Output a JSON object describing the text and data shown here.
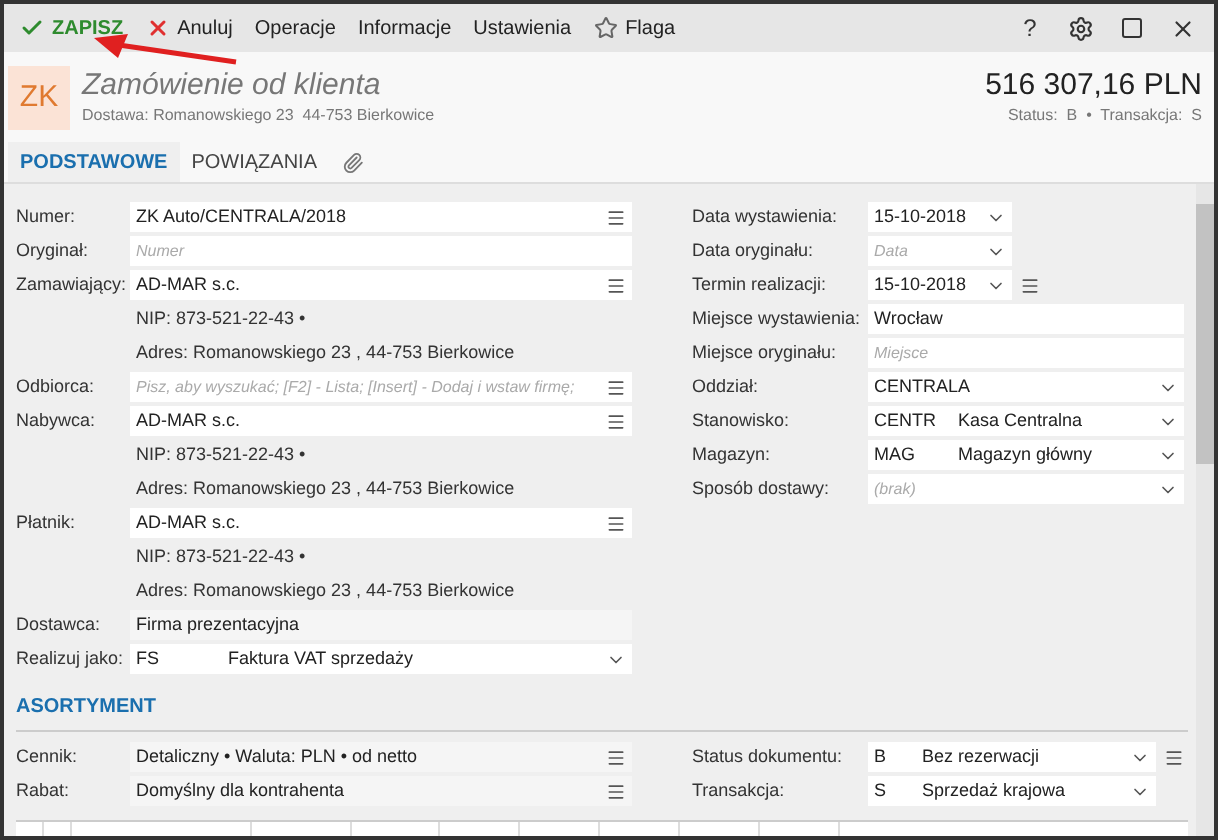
{
  "toolbar": [
    {
      "kind": "save",
      "label": "ZAPISZ"
    },
    {
      "kind": "cancel",
      "label": "Anuluj"
    },
    {
      "kind": "menu",
      "label": "Operacje"
    },
    {
      "kind": "menu",
      "label": "Informacje"
    },
    {
      "kind": "menu",
      "label": "Ustawienia"
    },
    {
      "kind": "flag",
      "label": "Flaga"
    }
  ],
  "window_controls": {
    "help": "?"
  },
  "header": {
    "badge": "ZK",
    "title": "Zamówienie od klienta",
    "subtitle": "Dostawa: Romanowskiego 23  44-753 Bierkowice",
    "amount": "516 307,16 PLN",
    "status": "Status:  B  •  Transakcja:  S"
  },
  "tabs": [
    {
      "kind": "text",
      "label": "PODSTAWOWE",
      "selected": true
    },
    {
      "kind": "text",
      "label": "POWIĄZANIA",
      "selected": false
    },
    {
      "kind": "attachment",
      "selected": false
    }
  ],
  "left_fields": [
    {
      "label": "Numer:",
      "kind": "input",
      "value": "ZK Auto/CENTRALA/2018",
      "menu": true
    },
    {
      "label": "Oryginał:",
      "kind": "input",
      "placeholder": "Numer",
      "menu": false
    },
    {
      "label": "Zamawiający:",
      "kind": "input",
      "value": "AD-MAR s.c.",
      "menu": true
    },
    {
      "kind": "info",
      "value": "NIP:  873-521-22-43  •"
    },
    {
      "kind": "info",
      "value": "Adres:  Romanowskiego 23 , 44-753 Bierkowice"
    },
    {
      "label": "Odbiorca:",
      "kind": "input",
      "placeholder": "Pisz, aby wyszukać; [F2] - Lista; [Insert] - Dodaj i wstaw firmę;",
      "menu": true
    },
    {
      "label": "Nabywca:",
      "kind": "input",
      "value": "AD-MAR s.c.",
      "menu": true
    },
    {
      "kind": "info",
      "value": "NIP:  873-521-22-43  •"
    },
    {
      "kind": "info",
      "value": "Adres:  Romanowskiego 23 , 44-753 Bierkowice"
    },
    {
      "label": "Płatnik:",
      "kind": "input",
      "value": "AD-MAR s.c.",
      "menu": true
    },
    {
      "kind": "info",
      "value": "NIP:  873-521-22-43  •"
    },
    {
      "kind": "info",
      "value": "Adres:  Romanowskiego 23 , 44-753 Bierkowice"
    },
    {
      "label": "Dostawca:",
      "kind": "readonly",
      "value": "Firma prezentacyjna"
    },
    {
      "label": "Realizuj jako:",
      "kind": "select",
      "code": "FS",
      "value": "Faktura VAT sprzedaży"
    }
  ],
  "right_fields": [
    {
      "label": "Data wystawienia:",
      "kind": "date",
      "value": "15-10-2018",
      "menu": false
    },
    {
      "label": "Data oryginału:",
      "kind": "date",
      "placeholder": "Data",
      "menu": false
    },
    {
      "label": "Termin realizacji:",
      "kind": "date",
      "value": "15-10-2018",
      "menu": true
    },
    {
      "label": "Miejsce wystawienia:",
      "kind": "input",
      "value": "Wrocław"
    },
    {
      "label": "Miejsce oryginału:",
      "kind": "input",
      "placeholder": "Miejsce"
    },
    {
      "label": "Oddział:",
      "kind": "select",
      "value": "CENTRALA"
    },
    {
      "label": "Stanowisko:",
      "kind": "select",
      "code": "CENTR",
      "value": "Kasa Centralna"
    },
    {
      "label": "Magazyn:",
      "kind": "select",
      "code": "MAG",
      "value": "Magazyn główny"
    },
    {
      "label": "Sposób dostawy:",
      "kind": "select",
      "placeholder": "(brak)"
    }
  ],
  "section": {
    "title": "ASORTYMENT"
  },
  "assortment_left": [
    {
      "label": "Cennik:",
      "value": "Detaliczny • Waluta: PLN • od netto"
    },
    {
      "label": "Rabat:",
      "value": "Domyślny dla kontrahenta"
    }
  ],
  "assortment_right": [
    {
      "label": "Status dokumentu:",
      "code": "B",
      "value": "Bez rezerwacji",
      "menu": true
    },
    {
      "label": "Transakcja:",
      "code": "S",
      "value": "Sprzedaż krajowa",
      "menu": false
    }
  ]
}
